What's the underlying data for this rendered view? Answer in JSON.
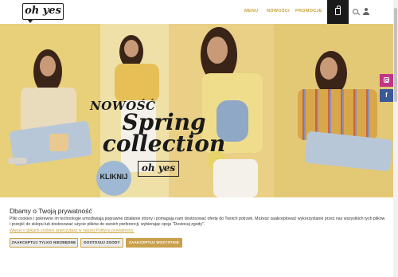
{
  "header": {
    "logo_text": "oh yes",
    "nav": [
      "MENU",
      "NOWOŚCI",
      "PROMOCJE"
    ]
  },
  "hero": {
    "label": "NOWOŚĆ",
    "title": "Spring collection",
    "cta_label": "KLIKNIJ",
    "logo_text": "oh yes"
  },
  "social": {
    "fb_label": "f"
  },
  "cookie": {
    "title": "Dbamy o Twoją prywatność",
    "text": "Pliki cookies i pokrewne im technologie umożliwiają poprawne działanie strony i pomagają nam dostosować ofertę do Twoich potrzeb. Możesz zaakceptować wykorzystanie przez nas wszystkich tych plików i przejść do sklepu lub dostosować użycie plików do swoich preferencji, wybierając opcję \"Dostosuj zgody\".",
    "link": "Więcej o plikach cookies przeczytasz w naszej Polityce prywatności.",
    "buttons": {
      "necessary": "ZAAKCEPTUJ TYLKO NIEZBĘDNE",
      "adjust": "DOSTOSUJ ZGODY",
      "accept_all": "ZAAKCEPTUJ WSZYSTKIE"
    }
  },
  "colors": {
    "accent": "#c9a23c",
    "hero_bg": "#eed98a",
    "cart_bg": "#1a1a1a",
    "accept_button": "#c9a04d"
  }
}
